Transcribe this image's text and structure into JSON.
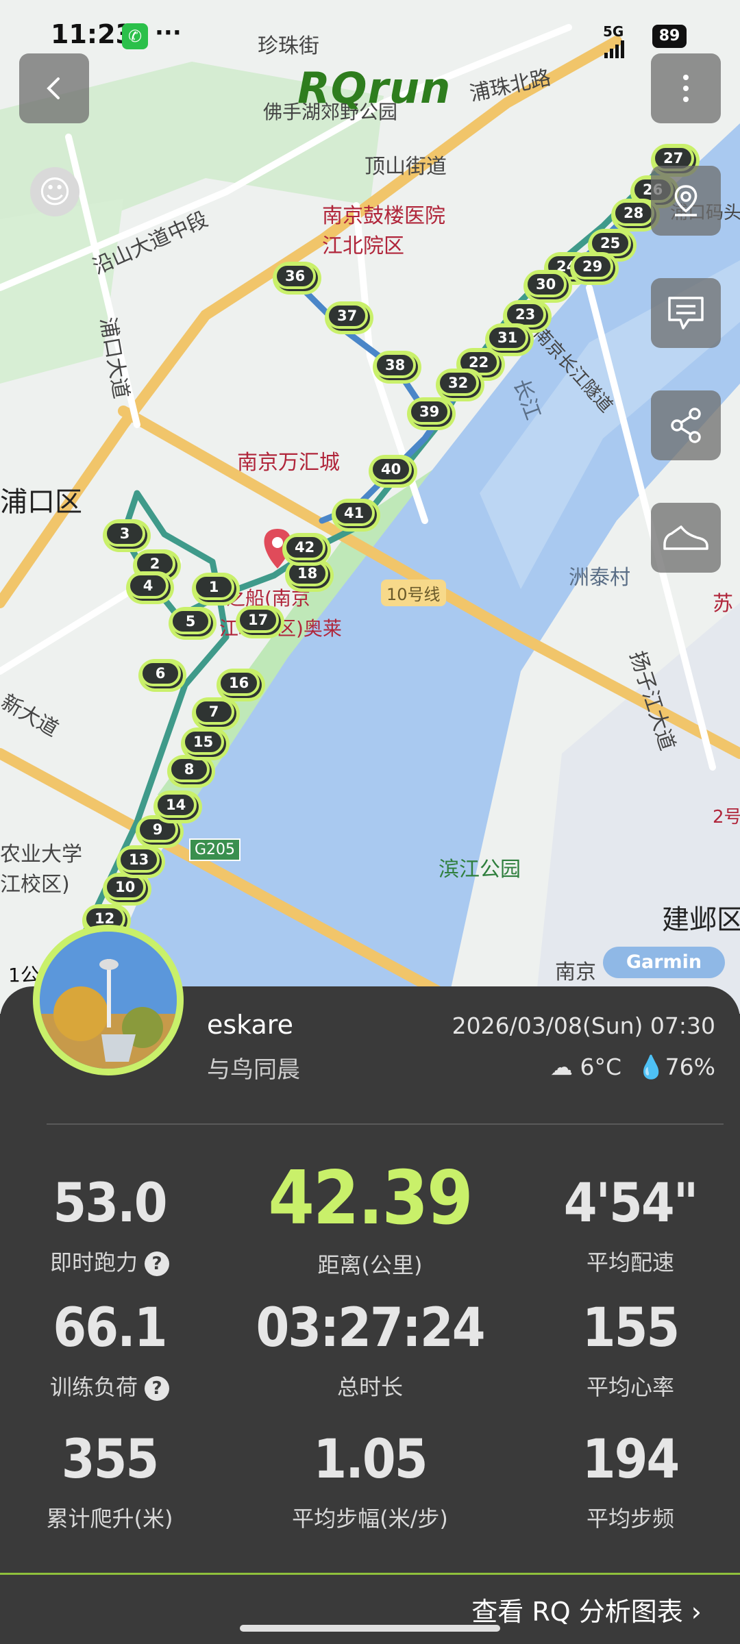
{
  "status_bar": {
    "time": "11:23",
    "more_dots": "···",
    "battery": "89",
    "signal": "5G"
  },
  "app": {
    "brand": "RQrun",
    "garmin_badge": "Garmin",
    "scale": "1公"
  },
  "map_labels": [
    {
      "text": "珍珠街"
    },
    {
      "text": "浦珠北路"
    },
    {
      "text": "佛手湖郊野公园"
    },
    {
      "text": "顶山街道"
    },
    {
      "text": "沿山大道中段"
    },
    {
      "text": "南京鼓楼医院"
    },
    {
      "text": "江北院区"
    },
    {
      "text": "浦口大道"
    },
    {
      "text": "浦口区"
    },
    {
      "text": "南京万汇城"
    },
    {
      "text": "之船(南京"
    },
    {
      "text": "江北新区)奥莱"
    },
    {
      "text": "10号线"
    },
    {
      "text": "洲泰村"
    },
    {
      "text": "扬子江大道"
    },
    {
      "text": "长江"
    },
    {
      "text": "G205"
    },
    {
      "text": "滨江公园"
    },
    {
      "text": "建邺区"
    },
    {
      "text": "农业大学"
    },
    {
      "text": "江校区)"
    },
    {
      "text": "新大道"
    },
    {
      "text": "南京"
    },
    {
      "text": "浦口码头"
    },
    {
      "text": "苏"
    },
    {
      "text": "2号"
    },
    {
      "text": "南京长江隧道"
    }
  ],
  "km_markers": [
    "1",
    "2",
    "3",
    "4",
    "5",
    "6",
    "7",
    "8",
    "9",
    "10",
    "12",
    "13",
    "14",
    "15",
    "16",
    "17",
    "18",
    "22",
    "23",
    "24",
    "25",
    "26",
    "27",
    "28",
    "29",
    "30",
    "31",
    "32",
    "36",
    "37",
    "38",
    "39",
    "40",
    "41",
    "42"
  ],
  "user": {
    "name": "eskare",
    "subtitle": "与鸟同晨",
    "datetime": "2026/03/08(Sun) 07:30",
    "temperature": "6°C",
    "humidity": "76%"
  },
  "stats": {
    "power": {
      "value": "53.0",
      "label": "即时跑力"
    },
    "distance": {
      "value": "42.39",
      "label": "距离(公里)"
    },
    "pace": {
      "value": "4'54\"",
      "label": "平均配速"
    },
    "load": {
      "value": "66.1",
      "label": "训练负荷"
    },
    "duration": {
      "value": "03:27:24",
      "label": "总时长"
    },
    "heart_rate": {
      "value": "155",
      "label": "平均心率"
    },
    "elevation": {
      "value": "355",
      "label": "累计爬升(米)"
    },
    "stride": {
      "value": "1.05",
      "label": "平均步幅(米/步)"
    },
    "cadence": {
      "value": "194",
      "label": "平均步频"
    }
  },
  "footer": {
    "more_link": "查看 RQ 分析图表 ›"
  },
  "colors": {
    "accent": "#c9f06a",
    "card_bg": "#3a3a3a",
    "route": "#3f9a8a",
    "water": "#a9c9f0",
    "park": "#bfe8b8"
  }
}
